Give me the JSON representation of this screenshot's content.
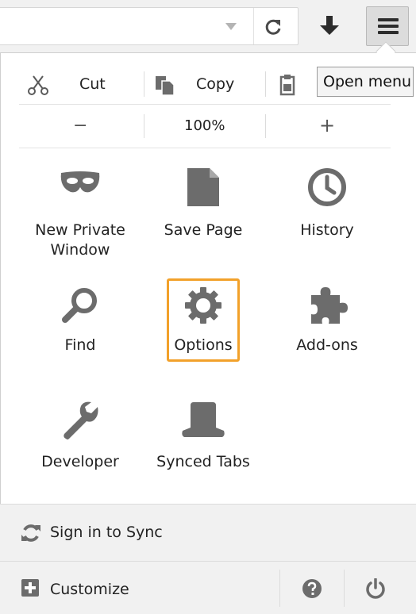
{
  "toolbar": {
    "dropdown_icon": "dropdown-arrow-icon",
    "reload_icon": "reload-icon",
    "download_icon": "download-arrow-icon",
    "menu_icon": "hamburger-menu-icon"
  },
  "tooltip": {
    "text": "Open menu"
  },
  "edit_controls": {
    "cut_label": "Cut",
    "copy_label": "Copy",
    "paste_icon": "paste-icon"
  },
  "zoom_controls": {
    "zoom_out_label": "−",
    "zoom_level": "100%",
    "zoom_in_label": "+"
  },
  "menu_items": [
    {
      "label_line1": "New Private",
      "label_line2": "Window",
      "icon": "private-mask-icon"
    },
    {
      "label": "Save Page",
      "icon": "save-page-icon"
    },
    {
      "label": "History",
      "icon": "history-clock-icon"
    },
    {
      "label": "Find",
      "icon": "find-magnifier-icon"
    },
    {
      "label": "Options",
      "icon": "options-gear-icon",
      "highlight_color": "#f2a12a"
    },
    {
      "label": "Add-ons",
      "icon": "addons-puzzle-icon"
    },
    {
      "label": "Developer",
      "icon": "developer-wrench-icon"
    },
    {
      "label": "Synced Tabs",
      "icon": "synced-tabs-icon"
    }
  ],
  "footer": {
    "sync_label": "Sign in to Sync",
    "customize_label": "Customize",
    "help_icon": "help-icon",
    "quit_icon": "power-icon"
  },
  "colors": {
    "icon_gray": "#6c6c6c",
    "highlight": "#f2a12a",
    "footer_bg": "#f1f1f1"
  }
}
